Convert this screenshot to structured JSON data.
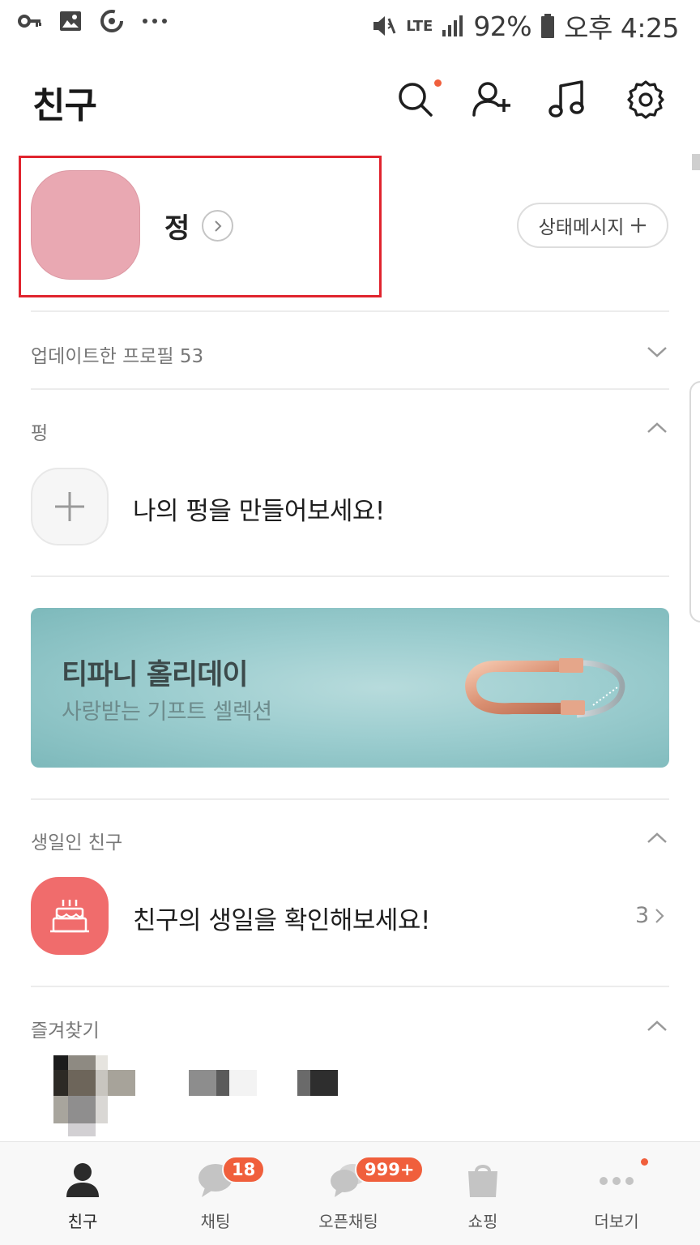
{
  "status_bar": {
    "battery": "92%",
    "time": "오후 4:25",
    "network": "LTE",
    "icons": [
      "key-icon",
      "image-icon",
      "sync-icon",
      "more-dots-icon",
      "mute-vibrate-icon",
      "signal-icon",
      "battery-icon"
    ]
  },
  "header": {
    "title": "친구",
    "icons": [
      "search-icon",
      "add-friend-icon",
      "music-icon",
      "settings-icon"
    ]
  },
  "profile": {
    "name": "정",
    "status_button": "상태메시지"
  },
  "sections": {
    "updated_profiles": "업데이트한 프로필 53",
    "pyeong": "펑",
    "pyeong_cta": "나의 펑을 만들어보세요!",
    "birthday": "생일인 친구",
    "birthday_cta": "친구의 생일을 확인해보세요!",
    "birthday_count": "3",
    "favorites": "즐겨찾기"
  },
  "banner": {
    "title": "티파니 홀리데이",
    "subtitle": "사랑받는 기프트 셀렉션"
  },
  "nav": {
    "items": [
      {
        "label": "친구",
        "icon": "person-icon",
        "active": true
      },
      {
        "label": "채팅",
        "icon": "chat-bubble-icon",
        "badge": "18"
      },
      {
        "label": "오픈채팅",
        "icon": "open-chat-icon",
        "badge": "999+"
      },
      {
        "label": "쇼핑",
        "icon": "shopping-bag-icon"
      },
      {
        "label": "더보기",
        "icon": "more-icon"
      }
    ]
  },
  "colors": {
    "accent": "#f05f3c",
    "highlight_border": "#e0242e",
    "avatar": "#e9a8b2",
    "birthday": "#f06c6c",
    "banner": "#9ccdcf"
  }
}
